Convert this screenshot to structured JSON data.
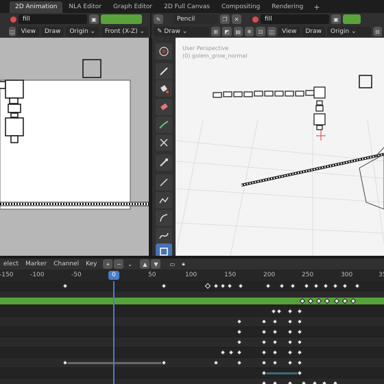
{
  "workspace_tabs": [
    "2D Animation",
    "NLA Editor",
    "Graph Editor",
    "2D Full Canvas",
    "Compositing",
    "Rendering"
  ],
  "tab_add": "+",
  "left_header": {
    "layer_name": "fill",
    "view_menu": "View",
    "draw_menu": "Draw",
    "origin": "Origin",
    "view_axis": "Front (X-Z)"
  },
  "right_header_top": {
    "mode": "Draw",
    "brush_name": "Pencil",
    "layer_name": "fill"
  },
  "right_header_bottom": {
    "mode": "Draw",
    "view_menu": "View",
    "draw_menu": "Draw",
    "origin": "Origin"
  },
  "viewport_overlay": {
    "line1": "User Perspective",
    "line2": "(0) golem_grow_normal"
  },
  "toolbar_tools": [
    "cursor-icon",
    "draw-icon",
    "fill-icon",
    "erase-icon",
    "tint-icon",
    "cutter-icon",
    "eyedropper-icon",
    "line-icon",
    "polyline-icon",
    "arc-icon",
    "curve-icon",
    "box-icon"
  ],
  "timeline_header": {
    "select": "elect",
    "marker": "Marker",
    "channel": "Channel",
    "key": "Key"
  },
  "timeline_ruler": [
    "-150",
    "-100",
    "-50",
    "0",
    "50",
    "100",
    "150",
    "200",
    "250",
    "300",
    "35"
  ],
  "current_frame": "0",
  "colors": {
    "accent": "#4772b3",
    "green_channel": "#57a13b",
    "layer_red": "#e04a4a",
    "playhead": "#4a7cc9"
  }
}
